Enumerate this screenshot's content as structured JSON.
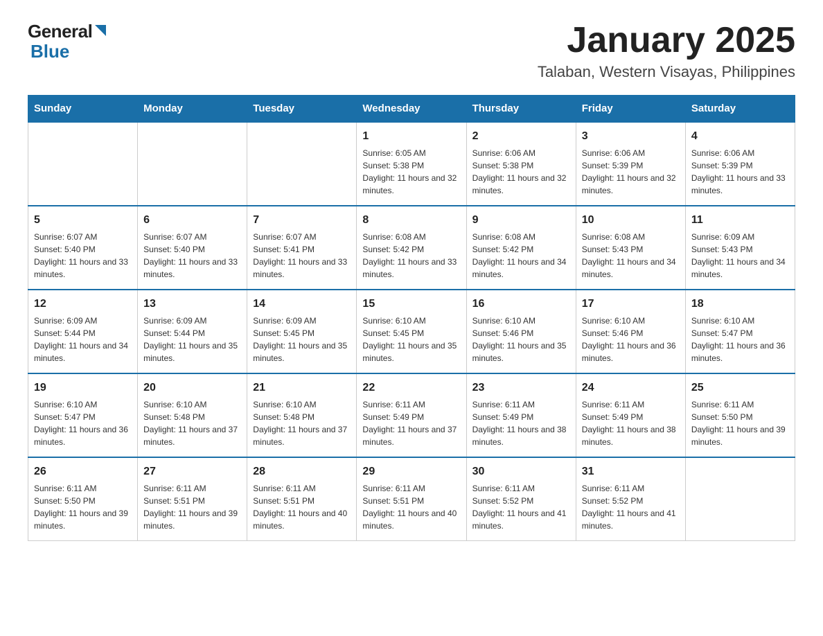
{
  "header": {
    "title": "January 2025",
    "subtitle": "Talaban, Western Visayas, Philippines",
    "logo_general": "General",
    "logo_blue": "Blue"
  },
  "days_of_week": [
    "Sunday",
    "Monday",
    "Tuesday",
    "Wednesday",
    "Thursday",
    "Friday",
    "Saturday"
  ],
  "weeks": [
    [
      {
        "day": "",
        "info": ""
      },
      {
        "day": "",
        "info": ""
      },
      {
        "day": "",
        "info": ""
      },
      {
        "day": "1",
        "info": "Sunrise: 6:05 AM\nSunset: 5:38 PM\nDaylight: 11 hours and 32 minutes."
      },
      {
        "day": "2",
        "info": "Sunrise: 6:06 AM\nSunset: 5:38 PM\nDaylight: 11 hours and 32 minutes."
      },
      {
        "day": "3",
        "info": "Sunrise: 6:06 AM\nSunset: 5:39 PM\nDaylight: 11 hours and 32 minutes."
      },
      {
        "day": "4",
        "info": "Sunrise: 6:06 AM\nSunset: 5:39 PM\nDaylight: 11 hours and 33 minutes."
      }
    ],
    [
      {
        "day": "5",
        "info": "Sunrise: 6:07 AM\nSunset: 5:40 PM\nDaylight: 11 hours and 33 minutes."
      },
      {
        "day": "6",
        "info": "Sunrise: 6:07 AM\nSunset: 5:40 PM\nDaylight: 11 hours and 33 minutes."
      },
      {
        "day": "7",
        "info": "Sunrise: 6:07 AM\nSunset: 5:41 PM\nDaylight: 11 hours and 33 minutes."
      },
      {
        "day": "8",
        "info": "Sunrise: 6:08 AM\nSunset: 5:42 PM\nDaylight: 11 hours and 33 minutes."
      },
      {
        "day": "9",
        "info": "Sunrise: 6:08 AM\nSunset: 5:42 PM\nDaylight: 11 hours and 34 minutes."
      },
      {
        "day": "10",
        "info": "Sunrise: 6:08 AM\nSunset: 5:43 PM\nDaylight: 11 hours and 34 minutes."
      },
      {
        "day": "11",
        "info": "Sunrise: 6:09 AM\nSunset: 5:43 PM\nDaylight: 11 hours and 34 minutes."
      }
    ],
    [
      {
        "day": "12",
        "info": "Sunrise: 6:09 AM\nSunset: 5:44 PM\nDaylight: 11 hours and 34 minutes."
      },
      {
        "day": "13",
        "info": "Sunrise: 6:09 AM\nSunset: 5:44 PM\nDaylight: 11 hours and 35 minutes."
      },
      {
        "day": "14",
        "info": "Sunrise: 6:09 AM\nSunset: 5:45 PM\nDaylight: 11 hours and 35 minutes."
      },
      {
        "day": "15",
        "info": "Sunrise: 6:10 AM\nSunset: 5:45 PM\nDaylight: 11 hours and 35 minutes."
      },
      {
        "day": "16",
        "info": "Sunrise: 6:10 AM\nSunset: 5:46 PM\nDaylight: 11 hours and 35 minutes."
      },
      {
        "day": "17",
        "info": "Sunrise: 6:10 AM\nSunset: 5:46 PM\nDaylight: 11 hours and 36 minutes."
      },
      {
        "day": "18",
        "info": "Sunrise: 6:10 AM\nSunset: 5:47 PM\nDaylight: 11 hours and 36 minutes."
      }
    ],
    [
      {
        "day": "19",
        "info": "Sunrise: 6:10 AM\nSunset: 5:47 PM\nDaylight: 11 hours and 36 minutes."
      },
      {
        "day": "20",
        "info": "Sunrise: 6:10 AM\nSunset: 5:48 PM\nDaylight: 11 hours and 37 minutes."
      },
      {
        "day": "21",
        "info": "Sunrise: 6:10 AM\nSunset: 5:48 PM\nDaylight: 11 hours and 37 minutes."
      },
      {
        "day": "22",
        "info": "Sunrise: 6:11 AM\nSunset: 5:49 PM\nDaylight: 11 hours and 37 minutes."
      },
      {
        "day": "23",
        "info": "Sunrise: 6:11 AM\nSunset: 5:49 PM\nDaylight: 11 hours and 38 minutes."
      },
      {
        "day": "24",
        "info": "Sunrise: 6:11 AM\nSunset: 5:49 PM\nDaylight: 11 hours and 38 minutes."
      },
      {
        "day": "25",
        "info": "Sunrise: 6:11 AM\nSunset: 5:50 PM\nDaylight: 11 hours and 39 minutes."
      }
    ],
    [
      {
        "day": "26",
        "info": "Sunrise: 6:11 AM\nSunset: 5:50 PM\nDaylight: 11 hours and 39 minutes."
      },
      {
        "day": "27",
        "info": "Sunrise: 6:11 AM\nSunset: 5:51 PM\nDaylight: 11 hours and 39 minutes."
      },
      {
        "day": "28",
        "info": "Sunrise: 6:11 AM\nSunset: 5:51 PM\nDaylight: 11 hours and 40 minutes."
      },
      {
        "day": "29",
        "info": "Sunrise: 6:11 AM\nSunset: 5:51 PM\nDaylight: 11 hours and 40 minutes."
      },
      {
        "day": "30",
        "info": "Sunrise: 6:11 AM\nSunset: 5:52 PM\nDaylight: 11 hours and 41 minutes."
      },
      {
        "day": "31",
        "info": "Sunrise: 6:11 AM\nSunset: 5:52 PM\nDaylight: 11 hours and 41 minutes."
      },
      {
        "day": "",
        "info": ""
      }
    ]
  ]
}
